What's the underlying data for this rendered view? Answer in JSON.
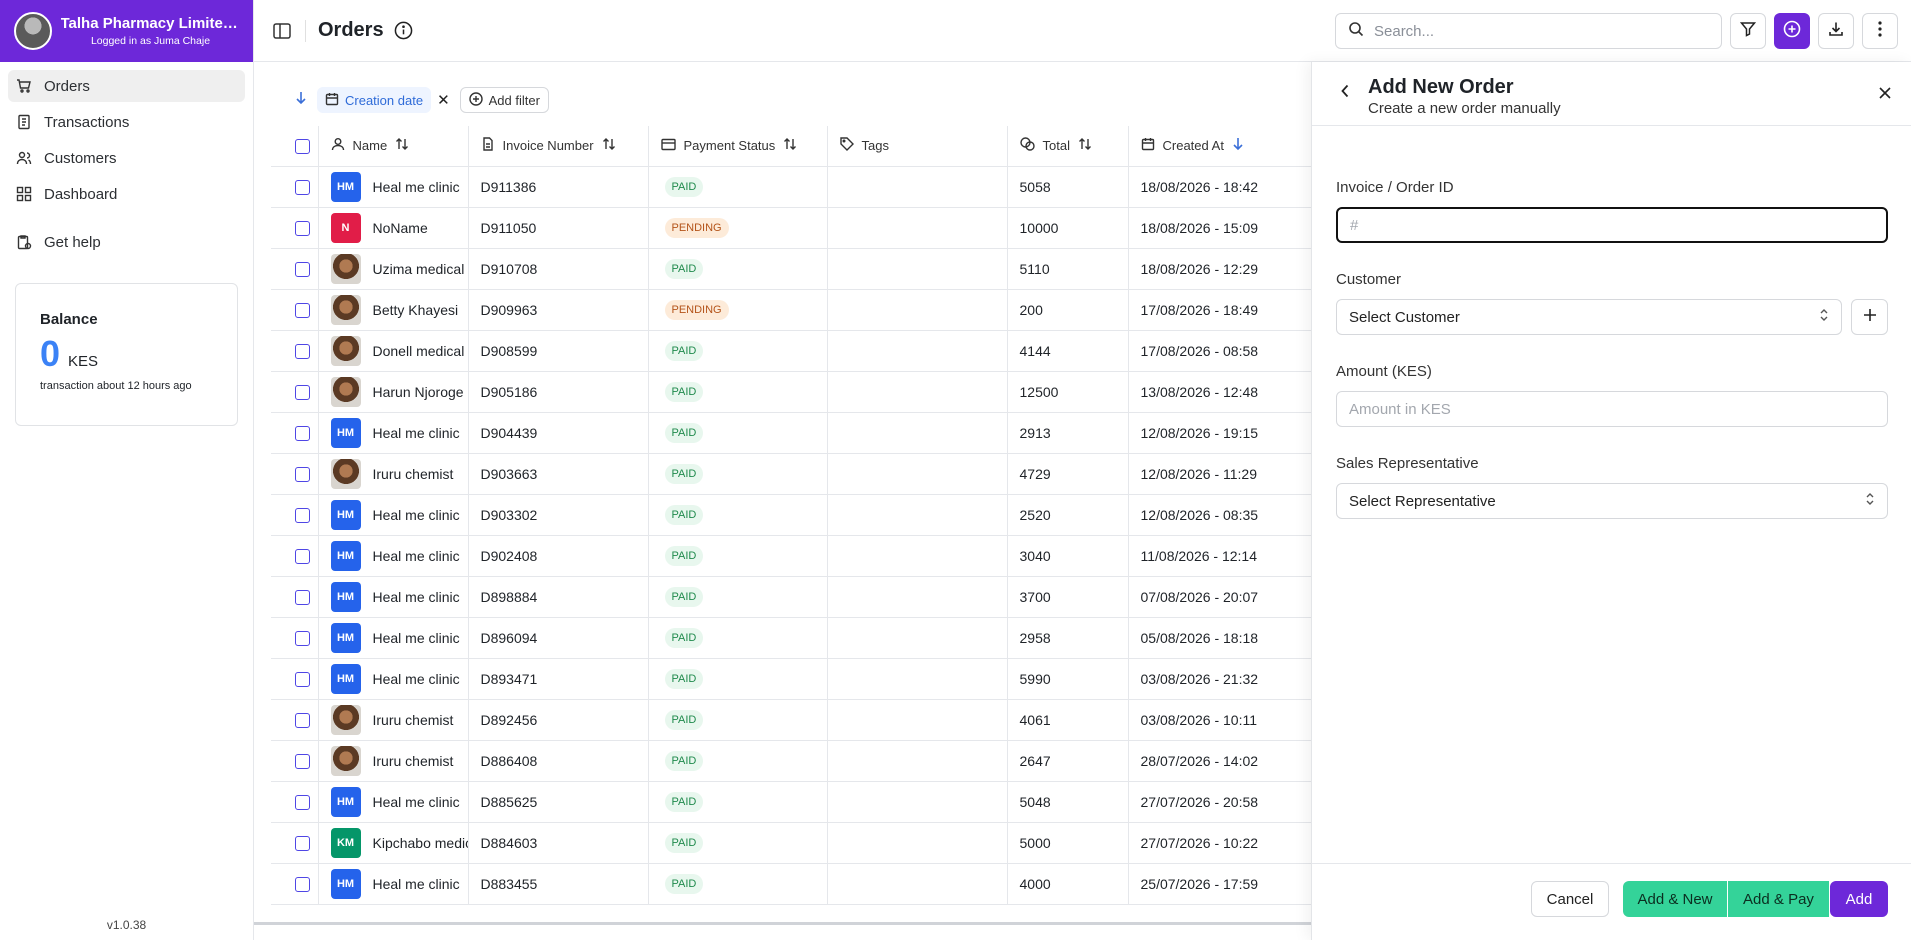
{
  "org": {
    "name": "Talha Pharmacy Limited -...",
    "subtitle": "Logged in as Juma Chaje"
  },
  "sidebar": {
    "items": [
      {
        "label": "Orders",
        "icon": "cart-icon",
        "active": true
      },
      {
        "label": "Transactions",
        "icon": "receipt-icon"
      },
      {
        "label": "Customers",
        "icon": "users-icon"
      },
      {
        "label": "Dashboard",
        "icon": "grid-icon"
      }
    ],
    "help": "Get help",
    "version": "v1.0.38"
  },
  "balance": {
    "title": "Balance",
    "amount": "0",
    "currency": "KES",
    "note": "transaction about 12 hours ago"
  },
  "header": {
    "title": "Orders",
    "search_placeholder": "Search..."
  },
  "filters": {
    "active_chip": "Creation date",
    "add_label": "Add filter"
  },
  "table": {
    "columns": [
      "Name",
      "Invoice Number",
      "Payment Status",
      "Tags",
      "Total",
      "Created At"
    ],
    "rows": [
      {
        "avatar": "HM",
        "avatar_type": "hm",
        "name": "Heal me clinic",
        "invoice": "D911386",
        "status": "PAID",
        "total": "5058",
        "created": "18/08/2026 - 18:42"
      },
      {
        "avatar": "N",
        "avatar_type": "n",
        "name": "NoName",
        "invoice": "D911050",
        "status": "PENDING",
        "total": "10000",
        "created": "18/08/2026 - 15:09"
      },
      {
        "avatar": "",
        "avatar_type": "photo",
        "name": "Uzima medical",
        "invoice": "D910708",
        "status": "PAID",
        "total": "5110",
        "created": "18/08/2026 - 12:29"
      },
      {
        "avatar": "",
        "avatar_type": "photo",
        "name": "Betty Khayesi",
        "invoice": "D909963",
        "status": "PENDING",
        "total": "200",
        "created": "17/08/2026 - 18:49"
      },
      {
        "avatar": "",
        "avatar_type": "photo",
        "name": "Donell medical",
        "invoice": "D908599",
        "status": "PAID",
        "total": "4144",
        "created": "17/08/2026 - 08:58"
      },
      {
        "avatar": "",
        "avatar_type": "photo",
        "name": "Harun Njoroge",
        "invoice": "D905186",
        "status": "PAID",
        "total": "12500",
        "created": "13/08/2026 - 12:48"
      },
      {
        "avatar": "HM",
        "avatar_type": "hm",
        "name": "Heal me clinic",
        "invoice": "D904439",
        "status": "PAID",
        "total": "2913",
        "created": "12/08/2026 - 19:15"
      },
      {
        "avatar": "",
        "avatar_type": "photo",
        "name": "Iruru chemist",
        "invoice": "D903663",
        "status": "PAID",
        "total": "4729",
        "created": "12/08/2026 - 11:29"
      },
      {
        "avatar": "HM",
        "avatar_type": "hm",
        "name": "Heal me clinic",
        "invoice": "D903302",
        "status": "PAID",
        "total": "2520",
        "created": "12/08/2026 - 08:35"
      },
      {
        "avatar": "HM",
        "avatar_type": "hm",
        "name": "Heal me clinic",
        "invoice": "D902408",
        "status": "PAID",
        "total": "3040",
        "created": "11/08/2026 - 12:14"
      },
      {
        "avatar": "HM",
        "avatar_type": "hm",
        "name": "Heal me clinic",
        "invoice": "D898884",
        "status": "PAID",
        "total": "3700",
        "created": "07/08/2026 - 20:07"
      },
      {
        "avatar": "HM",
        "avatar_type": "hm",
        "name": "Heal me clinic",
        "invoice": "D896094",
        "status": "PAID",
        "total": "2958",
        "created": "05/08/2026 - 18:18"
      },
      {
        "avatar": "HM",
        "avatar_type": "hm",
        "name": "Heal me clinic",
        "invoice": "D893471",
        "status": "PAID",
        "total": "5990",
        "created": "03/08/2026 - 21:32"
      },
      {
        "avatar": "",
        "avatar_type": "photo",
        "name": "Iruru chemist",
        "invoice": "D892456",
        "status": "PAID",
        "total": "4061",
        "created": "03/08/2026 - 10:11"
      },
      {
        "avatar": "",
        "avatar_type": "photo",
        "name": "Iruru chemist",
        "invoice": "D886408",
        "status": "PAID",
        "total": "2647",
        "created": "28/07/2026 - 14:02"
      },
      {
        "avatar": "HM",
        "avatar_type": "hm",
        "name": "Heal me clinic",
        "invoice": "D885625",
        "status": "PAID",
        "total": "5048",
        "created": "27/07/2026 - 20:58"
      },
      {
        "avatar": "KM",
        "avatar_type": "km",
        "name": "Kipchabo medical",
        "invoice": "D884603",
        "status": "PAID",
        "total": "5000",
        "created": "27/07/2026 - 10:22"
      },
      {
        "avatar": "HM",
        "avatar_type": "hm",
        "name": "Heal me clinic",
        "invoice": "D883455",
        "status": "PAID",
        "total": "4000",
        "created": "25/07/2026 - 17:59"
      }
    ]
  },
  "drawer": {
    "title": "Add New Order",
    "subtitle": "Create a new order manually",
    "invoice_label": "Invoice / Order ID",
    "invoice_placeholder": "#",
    "customer_label": "Customer",
    "customer_value": "Select Customer",
    "amount_label": "Amount (KES)",
    "amount_placeholder": "Amount in KES",
    "rep_label": "Sales Representative",
    "rep_value": "Select Representative",
    "cancel": "Cancel",
    "add_new": "Add & New",
    "add_pay": "Add & Pay",
    "add": "Add"
  },
  "colors": {
    "brand": "#6d28d9",
    "accent_blue": "#3b82f6",
    "green_button": "#34d399"
  }
}
